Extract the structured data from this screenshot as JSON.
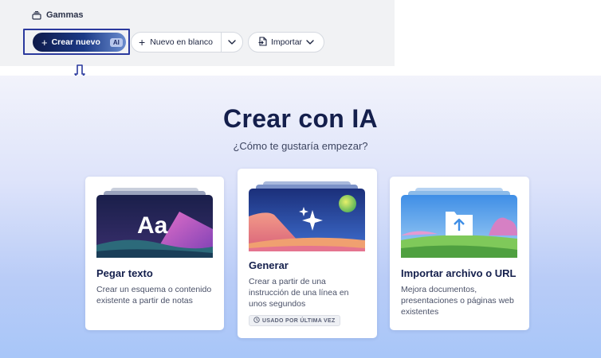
{
  "breadcrumb": {
    "label": "Gammas",
    "icon": "stack-icon"
  },
  "toolbar": {
    "create_label": "Crear nuevo",
    "create_badge": "AI",
    "blank_label": "Nuevo en blanco",
    "import_label": "Importar"
  },
  "hero": {
    "title": "Crear con IA",
    "subtitle": "¿Cómo te gustaría empezar?"
  },
  "cards": [
    {
      "title": "Pegar texto",
      "description": "Crear un esquema o contenido existente a partir de notas",
      "image_text": "Aa"
    },
    {
      "title": "Generar",
      "description": "Crear a partir de una instrucción de una línea en unos segundos",
      "badge": "USADO POR ÚLTIMA VEZ"
    },
    {
      "title": "Importar archivo o URL",
      "description": "Mejora documentos, presentaciones o páginas web existentes"
    }
  ],
  "colors": {
    "accent_dark": "#141f4c",
    "highlight_border": "#2b3a9e",
    "hero_bottom": "#a8c6f8"
  }
}
